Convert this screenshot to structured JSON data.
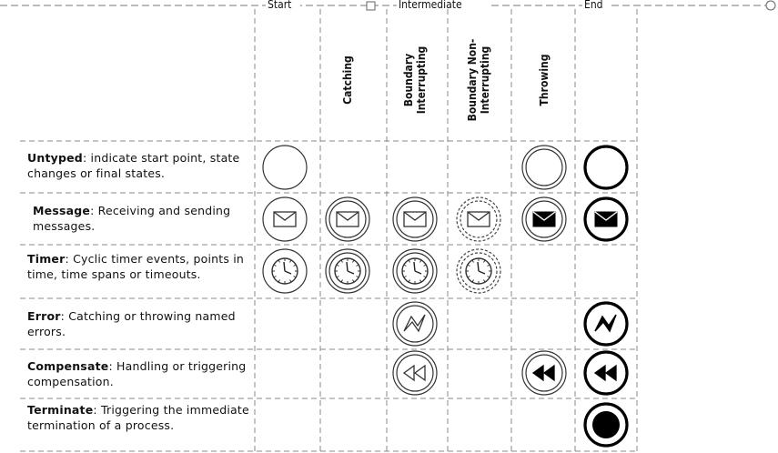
{
  "groups": {
    "start": "Start",
    "intermediate": "Intermediate",
    "end": "End"
  },
  "columns": [
    {
      "id": "catching",
      "label": [
        "Catching"
      ]
    },
    {
      "id": "boundary_interrupting",
      "label": [
        "Boundary",
        "Interrupting"
      ]
    },
    {
      "id": "boundary_non_interrupting",
      "label": [
        "Boundary Non-",
        "Interrupting"
      ]
    },
    {
      "id": "throwing",
      "label": [
        "Throwing"
      ]
    }
  ],
  "rows": [
    {
      "id": "untyped",
      "title": "Untyped",
      "text": ": indicate start point, state changes or final states.",
      "cells": {
        "start": "plain",
        "throwing": "plain-double",
        "end": "plain-thick"
      }
    },
    {
      "id": "message",
      "title": "Message",
      "text": ": Receiving and sending messages.",
      "cells": {
        "start": "envelope",
        "catching": "envelope-double",
        "interrupting": "envelope-double",
        "noninterrupting": "envelope-dashed",
        "throwing": "envelope-filled-double",
        "end": "envelope-filled-thick"
      }
    },
    {
      "id": "timer",
      "title": "Timer",
      "text": ": Cyclic timer events, points in time, time spans or timeouts.",
      "cells": {
        "start": "clock",
        "catching": "clock-double",
        "interrupting": "clock-double",
        "noninterrupting": "clock-dashed"
      }
    },
    {
      "id": "error",
      "title": "Error",
      "text": ": Catching or throwing named errors.",
      "cells": {
        "interrupting": "error-double",
        "end": "error-filled-thick"
      }
    },
    {
      "id": "compensate",
      "title": "Compensate",
      "text": ": Handling or triggering compensation.",
      "cells": {
        "interrupting": "rewind-double",
        "throwing": "rewind-filled-double",
        "end": "rewind-filled-thick"
      }
    },
    {
      "id": "terminate",
      "title": "Terminate",
      "text": ": Triggering the immediate termination of a process.",
      "cells": {
        "end": "terminate-thick"
      }
    }
  ],
  "icons": {
    "envelope": "envelope-icon",
    "clock": "clock-icon",
    "error": "lightning-icon",
    "compensate": "rewind-icon",
    "terminate": "filled-circle-icon"
  }
}
